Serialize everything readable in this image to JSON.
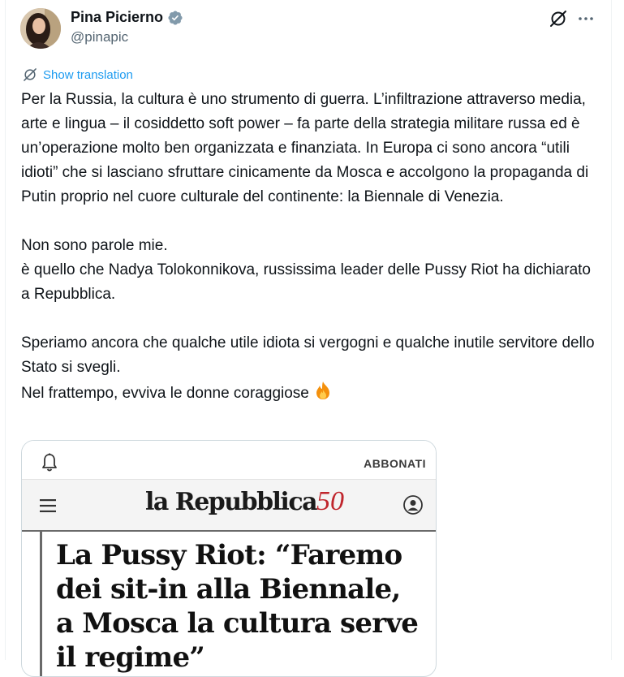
{
  "author": {
    "name": "Pina Picierno",
    "handle": "@pinapic"
  },
  "translation": {
    "label": "Show translation"
  },
  "tweet": {
    "paragraph1": "Per la Russia, la cultura è uno strumento di guerra. L’infiltrazione attraverso media, arte e lingua – il cosiddetto soft power – fa parte della strategia militare russa ed è un’operazione molto ben organizzata e finanziata. In Europa ci sono ancora “utili idioti” che si lasciano sfruttare cinicamente da Mosca e accolgono la propaganda di Putin proprio nel cuore culturale del continente: la Biennale di Venezia.",
    "paragraph2": "Non sono parole mie.\nè quello che Nadya Tolokonnikova, russissima leader delle Pussy Riot ha dichiarato a Repubblica.",
    "paragraph3": "Speriamo ancora che qualche utile idiota si vergogni e qualche inutile servitore dello Stato si svegli.\nNel frattempo, evviva le donne coraggiose"
  },
  "card": {
    "subscribe_label": "ABBONATI",
    "logo_text": "la Repubblica",
    "logo_number": "50",
    "headline": "La Pussy Riot: “Faremo dei sit-in alla Biennale, a Mosca la cultura serve il regime”"
  },
  "icons": {
    "verified": "verified-badge-icon",
    "grok": "grok-icon",
    "more": "more-options-icon",
    "translate": "translate-icon",
    "fire": "fire-emoji-icon",
    "bell": "bell-icon",
    "menu": "hamburger-menu-icon",
    "user": "user-account-icon"
  },
  "colors": {
    "accent": "#1d9bf0",
    "text": "#0f1419",
    "secondary": "#536471",
    "logo_red": "#c0262d"
  }
}
